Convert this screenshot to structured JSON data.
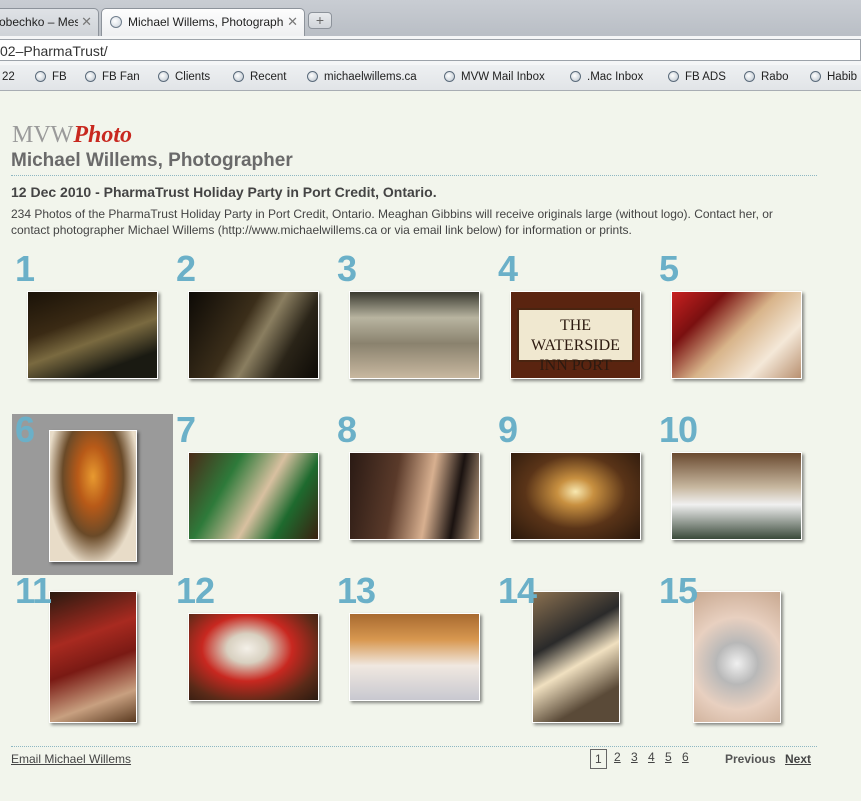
{
  "browser": {
    "tabs": [
      {
        "label": "obechko – Mes",
        "active": false
      },
      {
        "label": "Michael Willems, Photograph",
        "active": true
      }
    ],
    "new_tab_label": "+",
    "url": "02–PharmaTrust/",
    "bookmarks": [
      "22",
      "FB",
      "FB Fan",
      "Clients",
      "Recent",
      "michaelwillems.ca",
      "MVW Mail Inbox",
      ".Mac Inbox",
      "FB ADS",
      "Rabo",
      "Habib"
    ]
  },
  "site": {
    "logo_mvw": "MVW",
    "logo_photo": "Photo",
    "title": "Michael Willems, Photographer"
  },
  "gallery": {
    "heading": "12 Dec 2010 - PharmaTrust Holiday Party in Port Credit, Ontario.",
    "description": "234 Photos of the PharmaTrust Holiday Party in Port Credit, Ontario. Meaghan Gibbins will receive originals large (without logo). Contact her, or contact photographer Michael Willems (http://www.michaelwillems.ca or via email link below) for information or prints.",
    "thumbnails": [
      {
        "number": "1",
        "icon": "building-night-photo"
      },
      {
        "number": "2",
        "icon": "building-night-photo"
      },
      {
        "number": "3",
        "icon": "hotel-entrance-photo"
      },
      {
        "number": "4",
        "icon": "sign-photo",
        "sign_text": "THE WATERSIDE INN PORT CREDIT"
      },
      {
        "number": "5",
        "icon": "flowers-lobby-photo"
      },
      {
        "number": "6",
        "icon": "flower-arrangement-photo"
      },
      {
        "number": "7",
        "icon": "elves-photo"
      },
      {
        "number": "8",
        "icon": "guests-photo"
      },
      {
        "number": "9",
        "icon": "candles-photo"
      },
      {
        "number": "10",
        "icon": "banquet-tables-photo"
      },
      {
        "number": "11",
        "icon": "santa-chair-photo"
      },
      {
        "number": "12",
        "icon": "santa-photo"
      },
      {
        "number": "13",
        "icon": "buffet-photo"
      },
      {
        "number": "14",
        "icon": "server-champagne-photo"
      },
      {
        "number": "15",
        "icon": "ornaments-photo"
      }
    ],
    "selected_index": 6
  },
  "footer": {
    "email_link": "Email Michael Willems",
    "pages": [
      "1",
      "2",
      "3",
      "4",
      "5",
      "6"
    ],
    "current_page": "1",
    "previous_label": "Previous",
    "next_label": "Next"
  },
  "colors": {
    "page_background": "#f2f5ec",
    "number_color": "#6bb0c8",
    "logo_red": "#c8281f",
    "selected_cell": "#9a9a9a"
  }
}
